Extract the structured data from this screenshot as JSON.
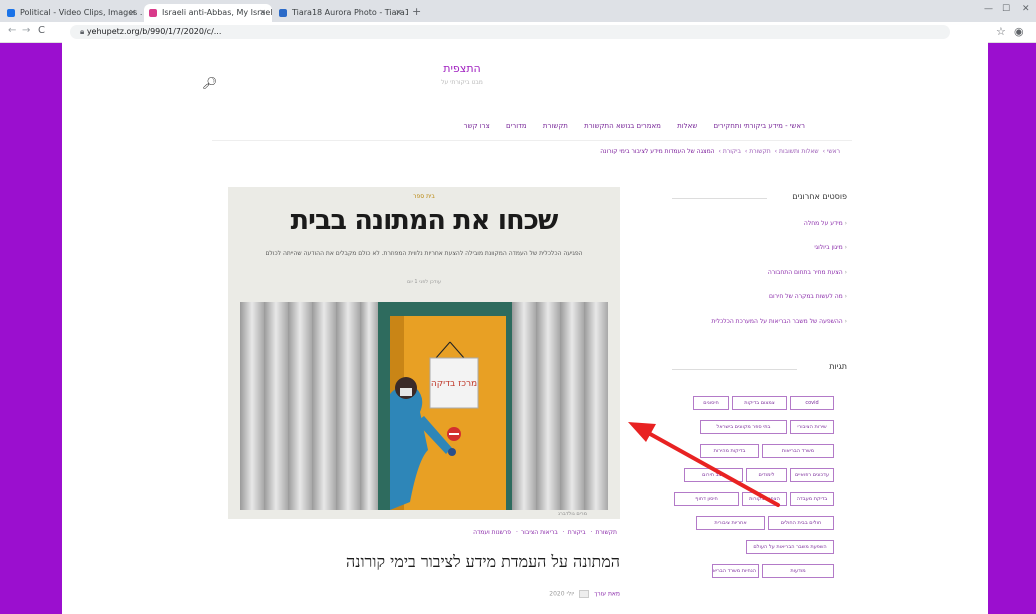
{
  "browser": {
    "tabs": [
      {
        "label": "Political - Video Clips, Images ..."
      },
      {
        "label": "Israeli anti-Abbas, My Israel...",
        "active": true
      },
      {
        "label": "Tiara18 Aurora Photo - Tiara18"
      }
    ],
    "new_tab": "+",
    "url": "yehupetz.org/b/990/1/7/2020/c/...",
    "back": "←",
    "forward": "→",
    "reload": "C"
  },
  "site": {
    "title": "התצפית",
    "tagline": "מבט ביקורתי על"
  },
  "nav": {
    "items": [
      "ראשי - מידע ביקורתי ותחקירים",
      "שאלות",
      "מאמרים בנושא התקשורת",
      "תקשורת",
      "מדורים",
      "צרו קשר"
    ]
  },
  "breadcrumb": {
    "items": [
      "ראשי",
      "שאלות ותשובות",
      "תקשורת",
      "ביקורת",
      "המצגה של העמדות מידע לציבור בימי קורונה"
    ]
  },
  "article": {
    "kicker": "בית ספר",
    "headline": "שכחו את המתונה בבית",
    "standfirst": "הפגיעה הכלכלית של העמדה המקוונת מובילה להצעת אחריות נלווית המפוזרת. לא כולם מקבלים את ההודעה שהייתה לכולם",
    "meta": "עודכן לפני 1 יום",
    "photo_caption": "מרים גולדברג",
    "sign_text": "מרכז בדיקה",
    "categories": [
      "תקשורת",
      "ביקורת",
      "בריאות הציבור",
      "פרשנות ועמדה"
    ],
    "title": "המתונה על העמדת מידע לציבור בימי קורונה",
    "author": "מאת עורך",
    "date": "יולי 2020"
  },
  "sidebar": {
    "recent_title": "פוסטים אחרונים",
    "recent": [
      "מידע על מחלה",
      "מיגון ביולוגי",
      "הצעת מחיר בתחום התחבורה",
      "מה לעשות במקרה של חירום",
      "ההשפעה של משבר הבריאות על המערכת הכלכלית"
    ],
    "tags_title": "תגיות",
    "tags": [
      "covid",
      "צמצום בדיקות",
      "חיסונים",
      "שירות הציבורי",
      "בתי ספר מקוונים בישראל",
      "משרד הבריאות",
      "בדיקות מהירות",
      "עדכונים רפואיים",
      "לימודים",
      "מצב חירום",
      "בדיקת מעבדה",
      "הצפה ובקורות",
      "חיסון דחוף",
      "חולים בבית החולים",
      "אחריות ציבורית",
      "השפעת משבר הבריאות על העולם",
      "מודעות",
      "הנחיות משרד הבריאות"
    ]
  },
  "colors": {
    "accent": "#9b0fcf",
    "link": "#8a2aaa",
    "annotation_arrow": "#e82222"
  }
}
